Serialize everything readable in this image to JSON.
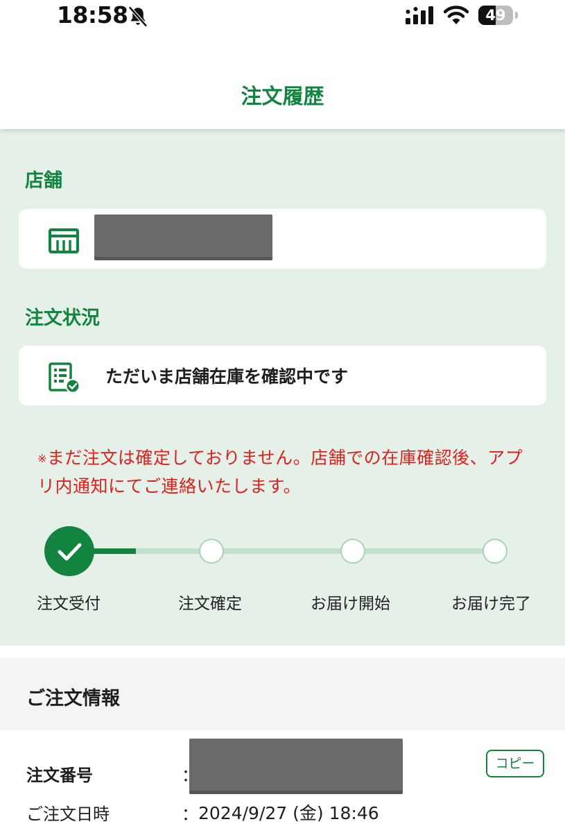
{
  "status_bar": {
    "time": "18:58",
    "battery": "49",
    "battery_level": 0.49,
    "icons": [
      "bell-slash-icon",
      "cellular-signal-icon",
      "wifi-icon",
      "battery-icon"
    ]
  },
  "header": {
    "title": "注文履歴"
  },
  "store": {
    "label": "店舗",
    "icon": "store-icon",
    "name_redacted": true
  },
  "order_status": {
    "label": "注文状況",
    "icon": "checklist-icon",
    "text": "ただいま店舗在庫を確認中です"
  },
  "notice": {
    "mark": "※",
    "text": "まだ注文は確定しておりません。店舗での在庫確認後、アプリ内通知にてご連絡いたします。"
  },
  "progress": {
    "current_step": 1,
    "steps": [
      {
        "label": "注文受付",
        "done": true
      },
      {
        "label": "注文確定",
        "done": false
      },
      {
        "label": "お届け開始",
        "done": false
      },
      {
        "label": "お届け完了",
        "done": false
      }
    ]
  },
  "order_info": {
    "title": "ご注文情報",
    "number_label": "注文番号",
    "number_separator": "：",
    "number_redacted": true,
    "copy_label": "コピー",
    "date_label": "ご注文日時",
    "date_separator": "：",
    "date_value": "2024/9/27 (金) 18:46"
  },
  "colors": {
    "brand_green": "#12843f",
    "section_bg": "#e5f1e8",
    "notice_red": "#e0201c"
  }
}
